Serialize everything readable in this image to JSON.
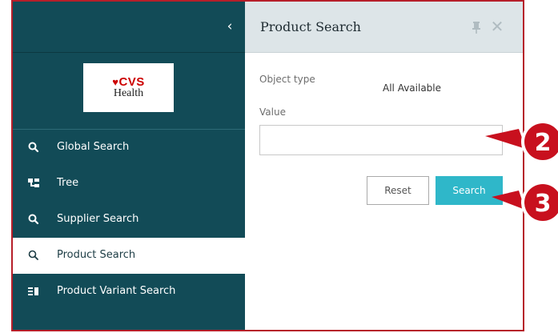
{
  "sidebar": {
    "collapse_glyph": "‹",
    "logo": {
      "brand": "CVS",
      "sub": "Health",
      "heart": "♥"
    },
    "items": [
      {
        "label": "Global Search",
        "icon": "search-icon"
      },
      {
        "label": "Tree",
        "icon": "tree-icon"
      },
      {
        "label": "Supplier Search",
        "icon": "search-icon"
      },
      {
        "label": "Product Search",
        "icon": "search-icon",
        "active": true
      },
      {
        "label": "Product Variant Search",
        "icon": "list-icon"
      }
    ]
  },
  "panel": {
    "title": "Product Search",
    "close_glyph": "✕",
    "object_type_label": "Object type",
    "object_type_value": "All Available",
    "value_label": "Value",
    "value_input": "",
    "value_placeholder": "",
    "reset_label": "Reset",
    "search_label": "Search"
  },
  "callouts": [
    {
      "number": "2"
    },
    {
      "number": "3"
    }
  ],
  "colors": {
    "sidebar_bg": "#124b57",
    "frame_border": "#b61f2a",
    "search_button": "#2fb7c9",
    "callout_red": "#c8101e",
    "header_bg": "#dde5e8"
  }
}
